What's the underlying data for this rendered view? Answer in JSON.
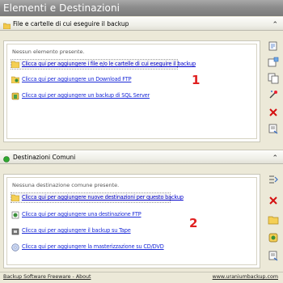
{
  "window": {
    "title": "Elementi e Destinazioni"
  },
  "elements_section": {
    "header": "File e cartelle di cui eseguire il backup",
    "empty_text": "Nessun elemento presente.",
    "items": [
      {
        "label": "Clicca qui per aggiungere i file e/o le cartelle di cui eseguire il backup",
        "icon": "folder-icon",
        "selected": true
      },
      {
        "label": "Clicca qui per aggiungere un Download FTP",
        "icon": "ftp-icon"
      },
      {
        "label": "Clicca qui per aggiungere un backup di SQL Server",
        "icon": "database-icon"
      }
    ],
    "marker": "1"
  },
  "destinations_section": {
    "header": "Destinazioni Comuni",
    "empty_text": "Nessuna destinazione comune presente.",
    "items": [
      {
        "label": "Clicca qui per aggiungere nuove destinazioni per questo backup",
        "icon": "folder-icon",
        "selected": true
      },
      {
        "label": "Clicca qui per aggiungere una destinazione FTP",
        "icon": "ftp-icon"
      },
      {
        "label": "Clicca qui per aggiungere il backup su Tape",
        "icon": "tape-icon"
      },
      {
        "label": "Clicca qui per aggiungere la masterizzazione su CD/DVD",
        "icon": "cd-icon"
      }
    ],
    "marker": "2"
  },
  "footer": {
    "left": "Backup Software Freeware - About",
    "right": "www.uraniumbackup.com"
  },
  "colors": {
    "title_bar": "#8c8c8c",
    "link": "#1a2ad8",
    "marker": "#e02020",
    "background": "#ece9d8"
  }
}
